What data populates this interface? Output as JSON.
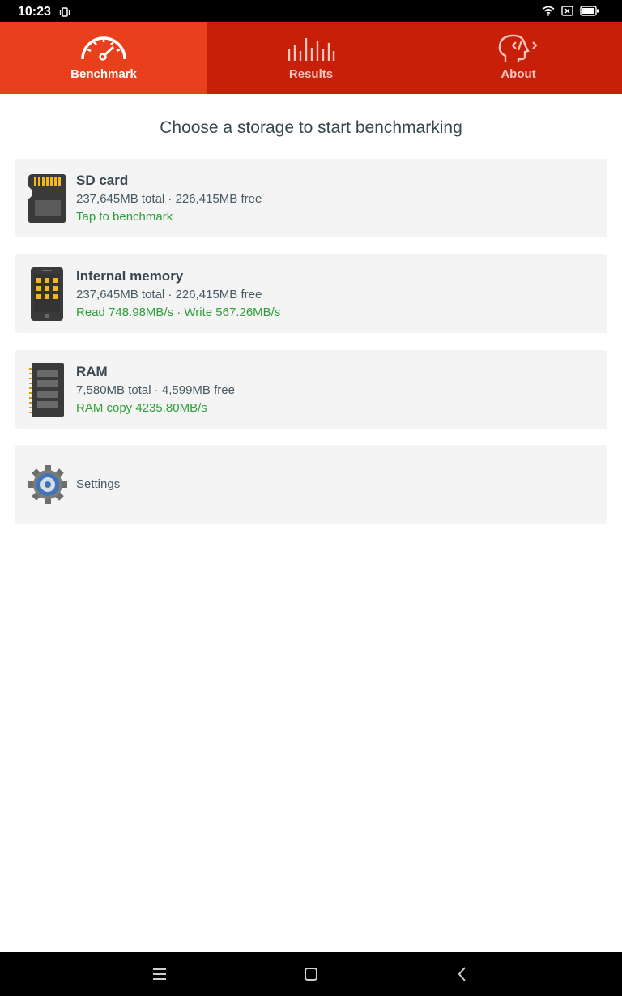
{
  "status_bar": {
    "time": "10:23",
    "icons": [
      "vibrate-icon",
      "wifi-icon",
      "no-sim-icon",
      "battery-icon"
    ]
  },
  "tabs": [
    {
      "label": "Benchmark",
      "icon": "speedometer-icon",
      "active": true
    },
    {
      "label": "Results",
      "icon": "bar-graph-icon",
      "active": false
    },
    {
      "label": "About",
      "icon": "head-code-icon",
      "active": false
    }
  ],
  "colors": {
    "tab_active": "#e8401c",
    "tab_bar": "#c81f08",
    "card_bg": "#f4f4f4",
    "title_text": "#37474f",
    "result_green": "#2e9f3a"
  },
  "main": {
    "heading": "Choose a storage to start benchmarking",
    "storages": [
      {
        "title": "SD card",
        "icon": "sd-card-icon",
        "capacity": "237,645MB total · 226,415MB free",
        "status": "Tap to benchmark"
      },
      {
        "title": "Internal memory",
        "icon": "phone-memory-icon",
        "capacity": "237,645MB total · 226,415MB free",
        "status": "Read 748.98MB/s · Write 567.26MB/s"
      },
      {
        "title": "RAM",
        "icon": "ram-chip-icon",
        "capacity": "7,580MB total · 4,599MB free",
        "status": "RAM copy 4235.80MB/s"
      }
    ],
    "settings": {
      "label": "Settings",
      "icon": "gear-icon"
    }
  },
  "navbar": {
    "buttons": [
      "menu-icon",
      "home-icon",
      "back-icon"
    ]
  }
}
